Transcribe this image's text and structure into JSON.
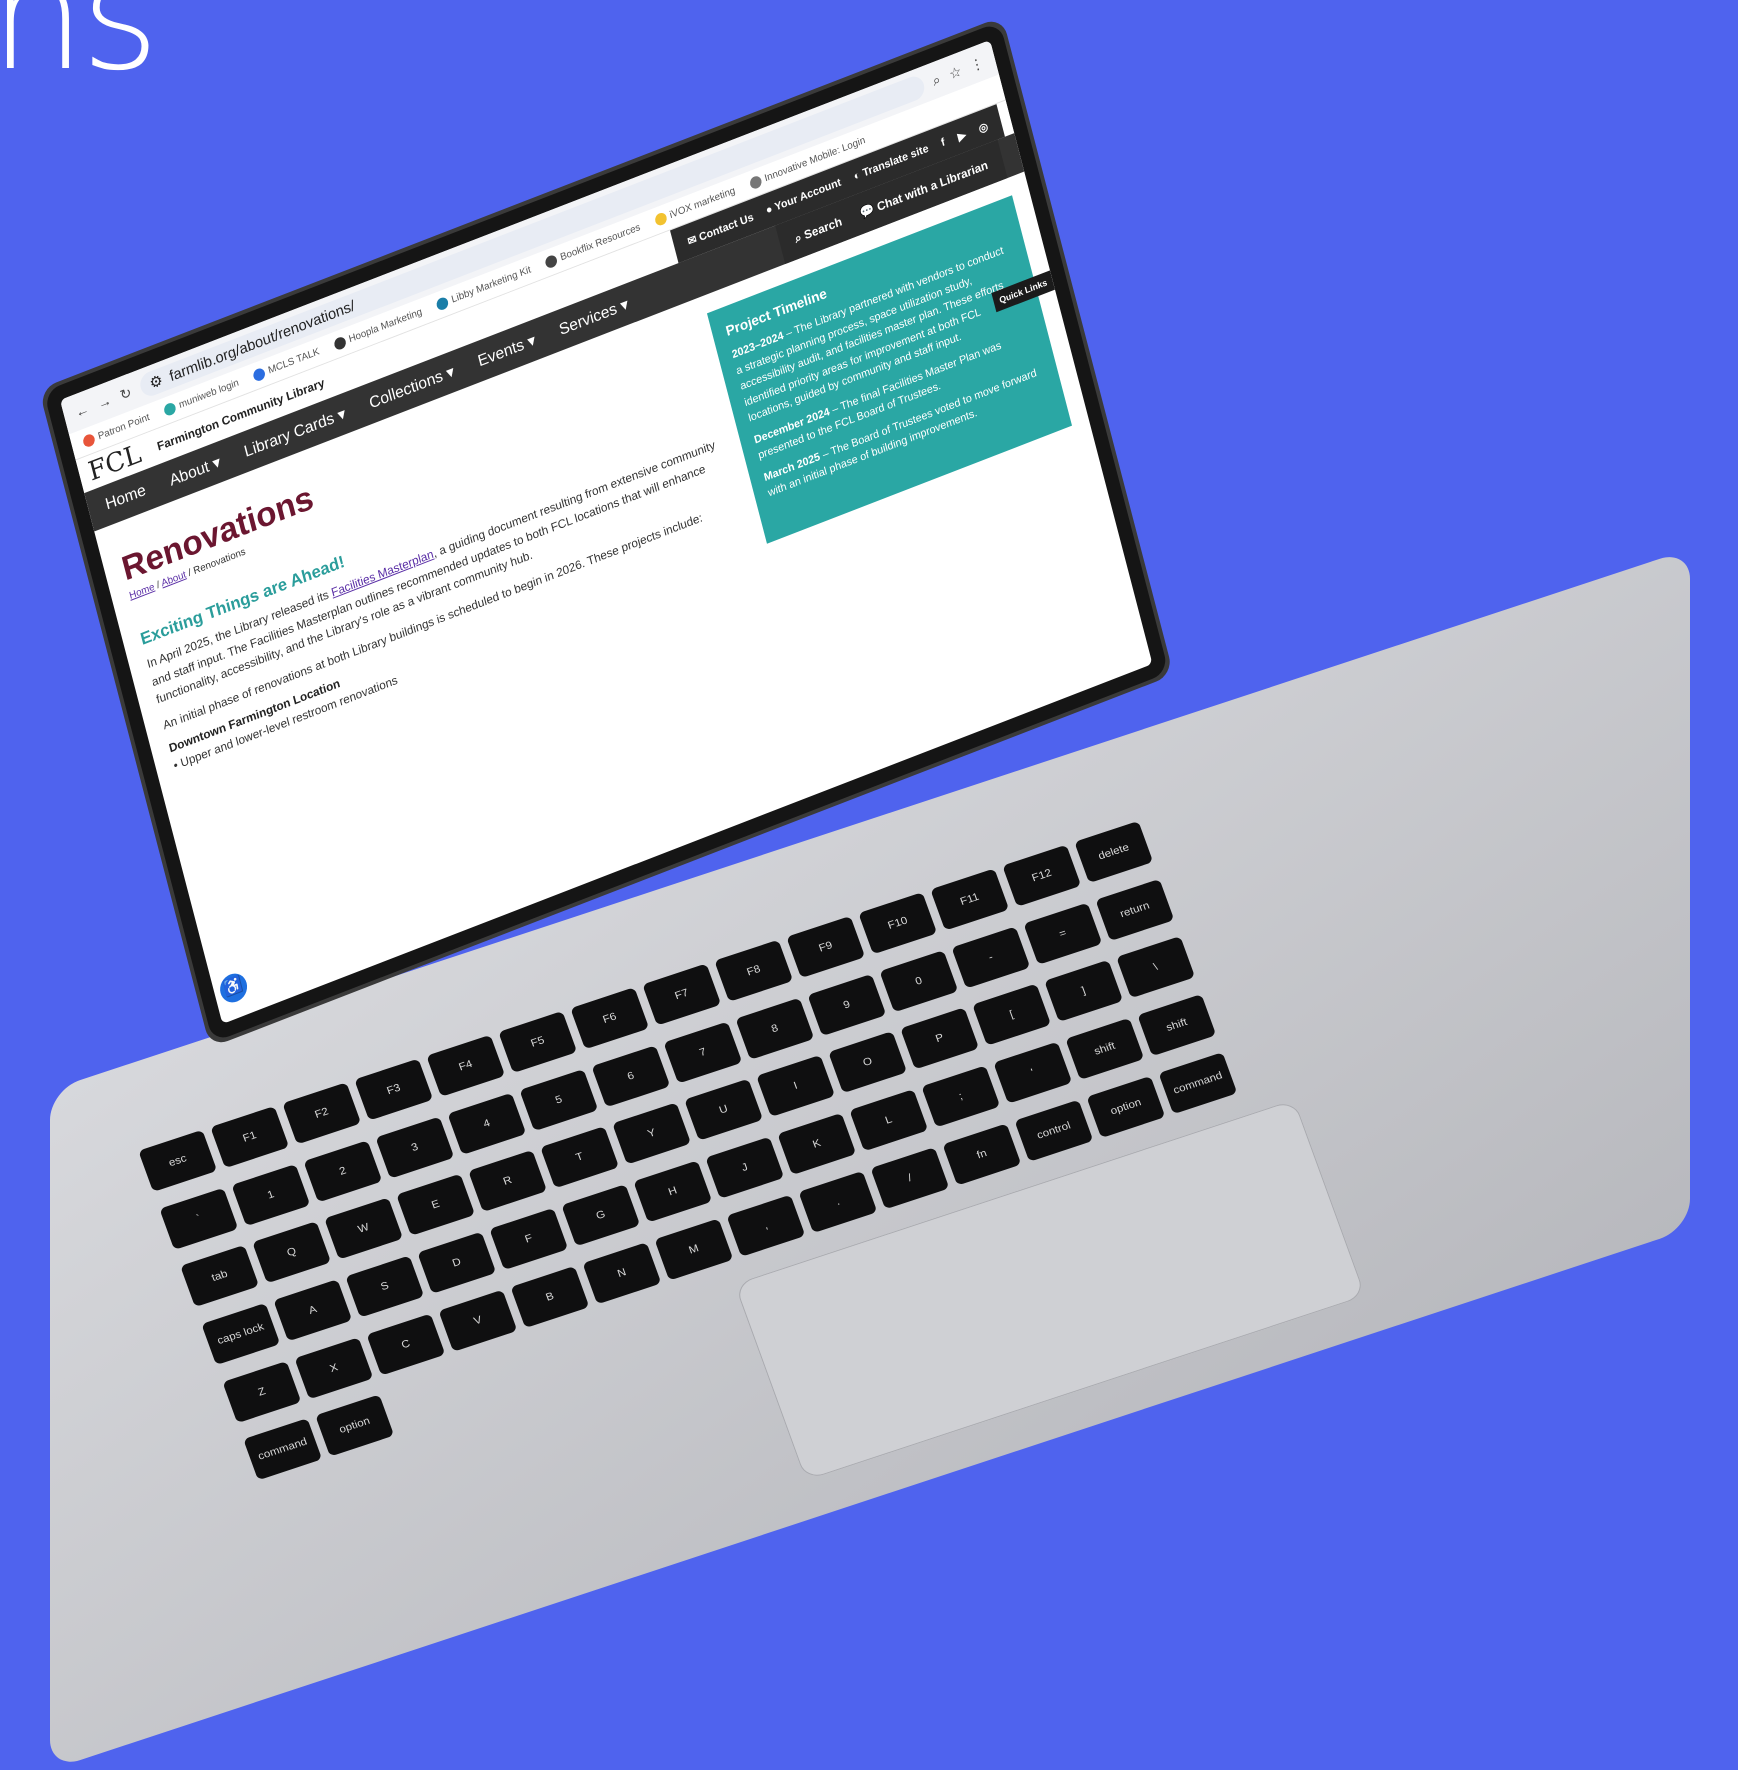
{
  "background_text": "ns",
  "browser": {
    "url": "farmlib.org/about/renovations/",
    "bookmarks": [
      "Patron Point",
      "muniweb login",
      "MCLS TALK",
      "Hoopla Marketing",
      "Libby Marketing Kit",
      "Bookflix Resources",
      "iVOX marketing",
      "Innovative Mobile: Login"
    ]
  },
  "site": {
    "logo": "FCL",
    "name": "Farmington Community Library",
    "utility": {
      "contact": "Contact Us",
      "account": "Your Account",
      "translate": "Translate site"
    },
    "nav": [
      "Home",
      "About",
      "Library Cards",
      "Collections",
      "Events",
      "Services"
    ],
    "search": "Search",
    "chat": "Chat with a Librarian",
    "quick_links": "Quick Links"
  },
  "page": {
    "title": "Renovations",
    "breadcrumb": {
      "home": "Home",
      "about": "About",
      "current": "Renovations"
    },
    "heading": "Exciting Things are Ahead!",
    "para1_a": "In April 2025, the Library released its ",
    "para1_link": "Facilities Masterplan",
    "para1_b": ", a guiding document resulting from extensive community and staff input. The Facilities Masterplan outlines recommended updates to both FCL locations that will enhance functionality, accessibility, and the Library's role as a vibrant community hub.",
    "para2": "An initial phase of renovations at both Library buildings is scheduled to begin in 2026. These projects include:",
    "location": "Downtown Farmington Location",
    "bullet": "Upper and lower-level restroom renovations"
  },
  "timeline": {
    "title": "Project Timeline",
    "item1_date": "2023–2024",
    "item1_text": " – The Library partnered with vendors to conduct a strategic planning process, space utilization study, accessibility audit, and facilities master plan. These efforts identified priority areas for improvement at both FCL locations, guided by community and staff input.",
    "item2_date": "December 2024",
    "item2_text": " – The final Facilities Master Plan was presented to the FCL Board of Trustees.",
    "item3_date": "March 2025",
    "item3_text": " – The Board of Trustees voted to move forward with an initial phase of building improvements."
  },
  "keyboard": [
    "esc",
    "F1",
    "F2",
    "F3",
    "F4",
    "F5",
    "F6",
    "F7",
    "F8",
    "F9",
    "F10",
    "F11",
    "F12",
    "delete",
    "`",
    "1",
    "2",
    "3",
    "4",
    "5",
    "6",
    "7",
    "8",
    "9",
    "0",
    "-",
    "=",
    "return",
    "tab",
    "Q",
    "W",
    "E",
    "R",
    "T",
    "Y",
    "U",
    "I",
    "O",
    "P",
    "[",
    "]",
    "\\",
    "caps lock",
    "A",
    "S",
    "D",
    "F",
    "G",
    "H",
    "J",
    "K",
    "L",
    ";",
    "'",
    "shift",
    "shift",
    "Z",
    "X",
    "C",
    "V",
    "B",
    "N",
    "M",
    ",",
    ".",
    "/",
    "fn",
    "control",
    "option",
    "command",
    "command",
    "option"
  ]
}
